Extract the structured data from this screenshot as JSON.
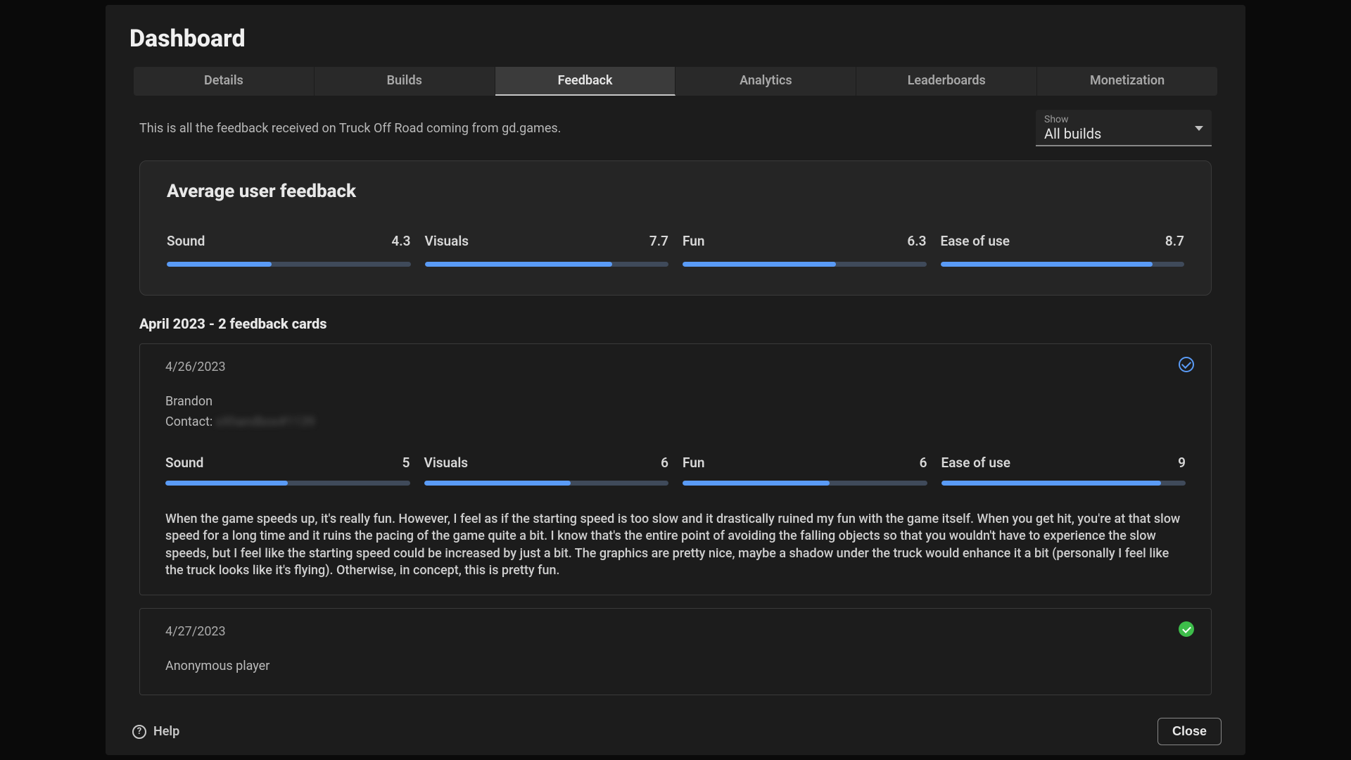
{
  "title": "Dashboard",
  "tabs": [
    "Details",
    "Builds",
    "Feedback",
    "Analytics",
    "Leaderboards",
    "Monetization"
  ],
  "active_tab": "Feedback",
  "intro": "This is all the feedback received on Truck Off Road coming from gd.games.",
  "filter": {
    "label": "Show",
    "value": "All builds"
  },
  "avg_panel": {
    "title": "Average user feedback",
    "metrics": [
      {
        "label": "Sound",
        "value": "4.3",
        "pct": 43
      },
      {
        "label": "Visuals",
        "value": "7.7",
        "pct": 77
      },
      {
        "label": "Fun",
        "value": "6.3",
        "pct": 63
      },
      {
        "label": "Ease of use",
        "value": "8.7",
        "pct": 87
      }
    ]
  },
  "section_header": "April 2023 - 2 feedback cards",
  "cards": [
    {
      "date": "4/26/2023",
      "author": "Brandon",
      "contact_label": "Contact:",
      "contact_value": "xXhandbox#1139",
      "status": "open",
      "metrics": [
        {
          "label": "Sound",
          "value": "5",
          "pct": 50
        },
        {
          "label": "Visuals",
          "value": "6",
          "pct": 60
        },
        {
          "label": "Fun",
          "value": "6",
          "pct": 60
        },
        {
          "label": "Ease of use",
          "value": "9",
          "pct": 90
        }
      ],
      "comment": "When the game speeds up, it's really fun. However, I feel as if the starting speed is too slow and it drastically ruined my fun with the game itself. When you get hit, you're at that slow speed for a long time and it ruins the pacing of the game quite a bit. I know that's the entire point of avoiding the falling objects so that you wouldn't have to experience the slow speeds, but I feel like the starting speed could be increased by just a bit. The graphics are pretty nice, maybe a shadow under the truck would enhance it a bit (personally I feel like the truck looks like it's flying). Otherwise, in concept, this is pretty fun."
    },
    {
      "date": "4/27/2023",
      "author": "Anonymous player",
      "contact_label": "",
      "contact_value": "",
      "status": "done",
      "metrics": [],
      "comment": ""
    }
  ],
  "footer": {
    "help": "Help",
    "close": "Close"
  }
}
